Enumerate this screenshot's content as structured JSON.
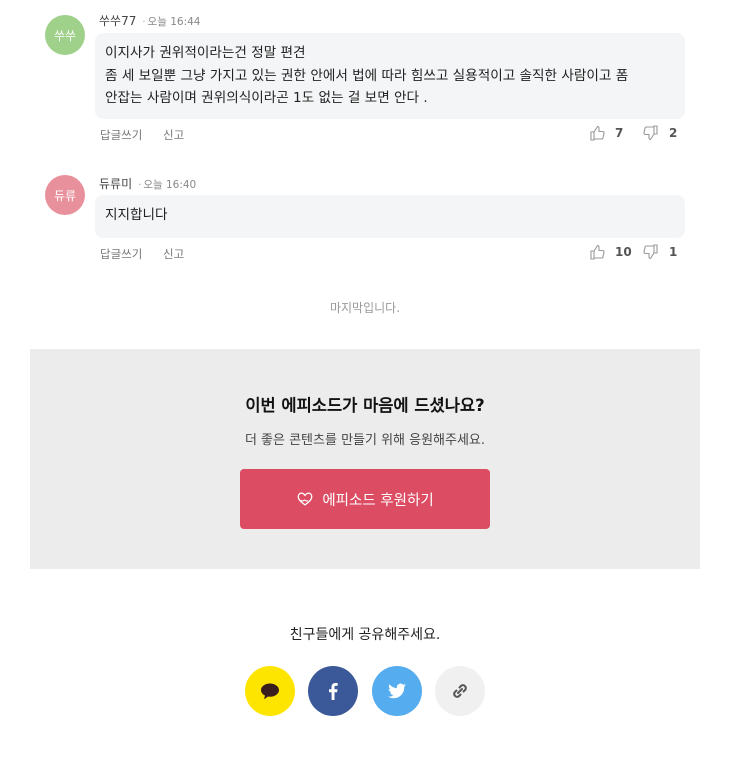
{
  "comments": [
    {
      "avatar_text": "쑤쑤",
      "avatar_color": "#9fd18b",
      "author": "쑤쑤77",
      "dot": "·",
      "time": "오늘 16:44",
      "lines": [
        "이지사가 권위적이라는건 정말 편견",
        "좀 세 보일뿐 그냥 가지고 있는 권한 안에서 법에 따라 힘쓰고 실용적이고 솔직한 사람이고 폼",
        "안잡는 사람이며 권위의식이라곤 1도 없는 걸 보면 안다 ."
      ],
      "reply_label": "답글쓰기",
      "report_label": "신고",
      "likes": "7",
      "dislikes": "2"
    },
    {
      "avatar_text": "듀류",
      "avatar_color": "#e8909c",
      "author": "듀류미",
      "dot": "·",
      "time": "오늘 16:40",
      "lines": [
        "지지합니다"
      ],
      "reply_label": "답글쓰기",
      "report_label": "신고",
      "likes": "10",
      "dislikes": "1"
    }
  ],
  "end_text": "마지막입니다.",
  "support": {
    "title": "이번 에피소드가 마음에 드셨나요?",
    "subtitle": "더 좋은 콘텐츠를 만들기 위해 응원해주세요.",
    "button_label": "에피소드 후원하기",
    "button_icon": "heart-hand-icon",
    "button_color": "#dc4c63"
  },
  "share": {
    "title": "친구들에게 공유해주세요.",
    "buttons": [
      {
        "name": "kakaotalk",
        "icon": "speech-bubble-icon",
        "bg": "#fee500",
        "fg": "#3a1d1d"
      },
      {
        "name": "facebook",
        "icon": "facebook-icon",
        "bg": "#3b5998",
        "fg": "#ffffff"
      },
      {
        "name": "twitter",
        "icon": "twitter-icon",
        "bg": "#55acee",
        "fg": "#ffffff"
      },
      {
        "name": "link",
        "icon": "link-icon",
        "bg": "#f0f0f0",
        "fg": "#555555"
      }
    ]
  }
}
